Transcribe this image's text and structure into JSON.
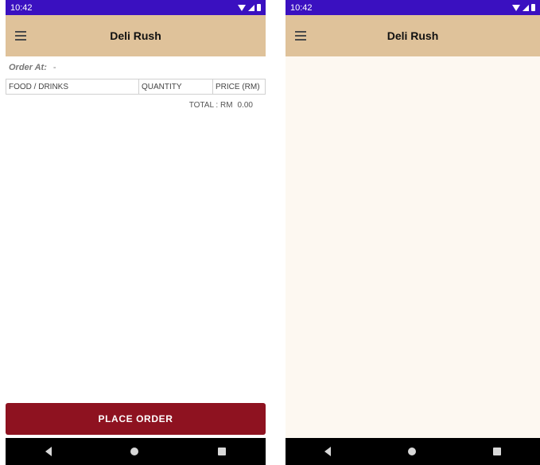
{
  "status_bar": {
    "time": "10:42"
  },
  "app": {
    "title": "Deli Rush"
  },
  "order": {
    "order_at_label": "Order At:",
    "order_at_value": "-",
    "columns": [
      "FOOD / DRINKS",
      "QUANTITY",
      "PRICE (RM)"
    ],
    "total_label": "TOTAL : RM",
    "total_value": "0.00"
  },
  "actions": {
    "place_order_label": "PLACE ORDER"
  },
  "colors": {
    "status_bar": "#3a10c0",
    "app_bar": "#dfc29a",
    "place_order_button": "#8e1220",
    "right_background": "#fdf8f1"
  },
  "icons": [
    "menu-icon",
    "wifi-icon",
    "signal-icon",
    "battery-icon",
    "back-icon",
    "home-icon",
    "recents-icon"
  ]
}
